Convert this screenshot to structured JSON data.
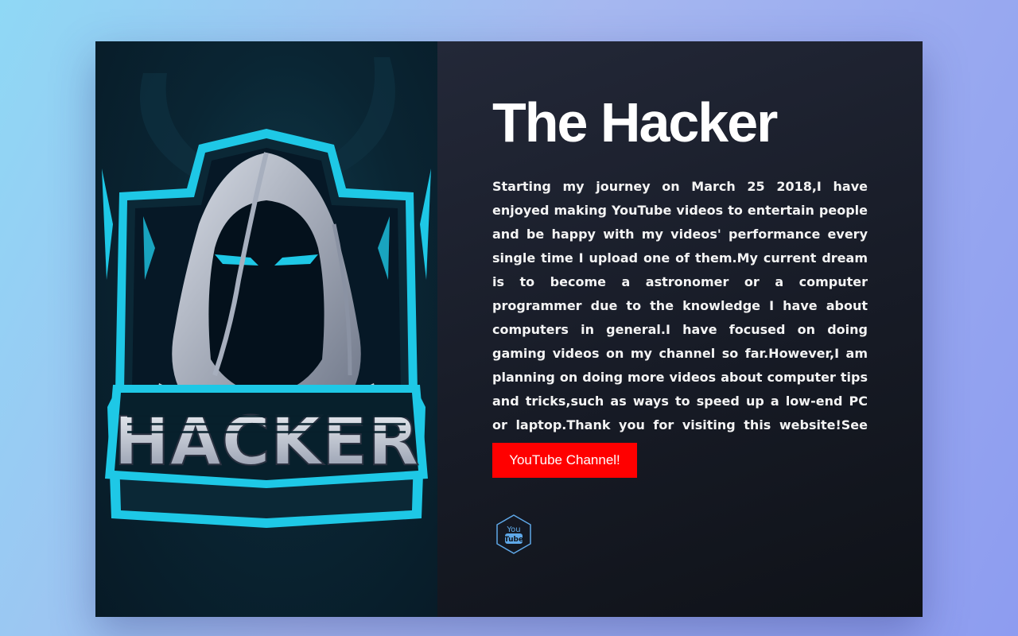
{
  "hero": {
    "logo_text": "HACKER",
    "title": "The Hacker",
    "bio": "Starting my journey on March 25 2018,I have enjoyed making YouTube videos to entertain people and be happy with my videos' performance every single time I upload one of them.My current dream is to become a astronomer or a computer programmer due to the knowledge I have about computers in general.I have focused on doing gaming videos on my channel so far.However,I am planning on doing more videos about computer tips and tricks,such as ways to speed up a low-end PC or laptop.Thank you for visiting this website!See you on YouTube!",
    "button_label": "YouTube Channel!"
  },
  "social": {
    "icon": "youtube-icon",
    "icon_text_top": "You",
    "icon_text_bottom": "Tube"
  },
  "colors": {
    "button": "#ff0000",
    "accent_cyan": "#1ec8e6",
    "panel_dark": "#171b26"
  }
}
